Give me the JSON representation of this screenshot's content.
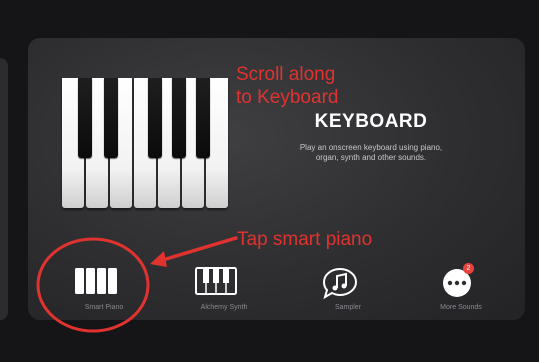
{
  "annotations": {
    "scroll_line1": "Scroll along",
    "scroll_line2": "to Keyboard",
    "tap": "Tap smart piano"
  },
  "instrument": {
    "title": "KEYBOARD",
    "description_line1": "Play an onscreen keyboard using piano,",
    "description_line2": "organ, synth and other sounds."
  },
  "toolbar": {
    "items": [
      {
        "label": "Smart Piano",
        "icon": "smart-piano-icon"
      },
      {
        "label": "Alchemy Synth",
        "icon": "alchemy-synth-icon"
      },
      {
        "label": "Sampler",
        "icon": "sampler-music-note-icon"
      },
      {
        "label": "More Sounds",
        "icon": "more-ellipsis-icon"
      }
    ],
    "more_sounds_badge": "2"
  },
  "colors": {
    "annotation_red": "#e0332f",
    "background": "#151517",
    "card": "#2e2e31",
    "badge": "#e8443d"
  }
}
